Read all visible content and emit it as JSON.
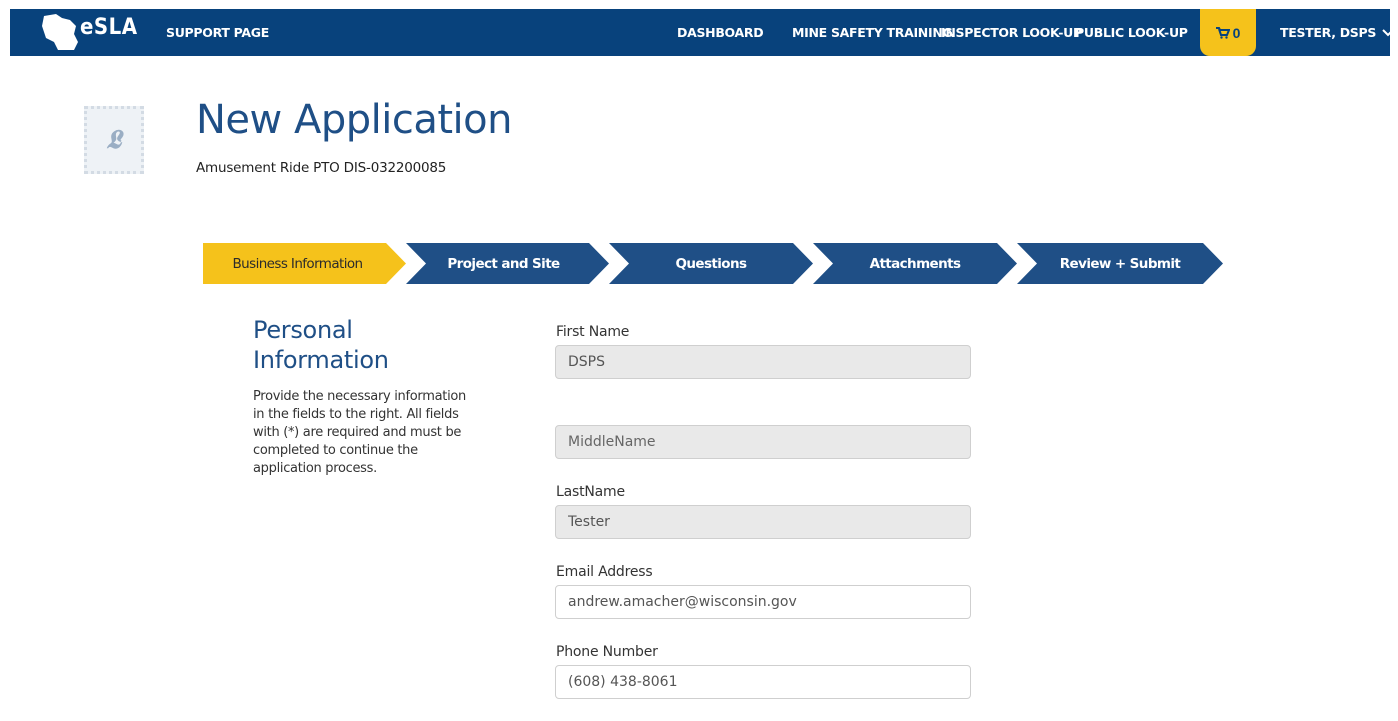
{
  "nav": {
    "brand": "eSLA",
    "support": "SUPPORT PAGE",
    "links": [
      "DASHBOARD",
      "MINE SAFETY TRAINING",
      "INSPECTOR LOOK-UP",
      "PUBLIC LOOK-UP"
    ],
    "cart_count": "0",
    "user": "TESTER, DSPS",
    "icons": {
      "cart": "cart-icon",
      "user_menu": "chevron-down-icon",
      "brand": "wisconsin-map-icon"
    }
  },
  "header": {
    "title": "New Application",
    "subtitle": "Amusement Ride PTO DIS-032200085"
  },
  "steps": [
    {
      "label": "Business Information",
      "active": true
    },
    {
      "label": "Project and Site",
      "active": false
    },
    {
      "label": "Questions",
      "active": false
    },
    {
      "label": "Attachments",
      "active": false
    },
    {
      "label": "Review + Submit",
      "active": false
    }
  ],
  "colors": {
    "primary": "#08427c",
    "accent": "#f5c21b",
    "step": "#1f4f86"
  },
  "section": {
    "title": "Personal Information",
    "description": "Provide the necessary information in the fields to the right. All fields with (*) are required and must be completed to continue the application process."
  },
  "form": {
    "first_name": {
      "label": "First Name",
      "value": "DSPS"
    },
    "middle_name": {
      "placeholder": "MiddleName"
    },
    "last_name": {
      "label": "LastName",
      "value": "Tester"
    },
    "email": {
      "label": "Email Address",
      "value": "andrew.amacher@wisconsin.gov"
    },
    "phone": {
      "label": "Phone Number",
      "value": "(608) 438-8061"
    }
  }
}
